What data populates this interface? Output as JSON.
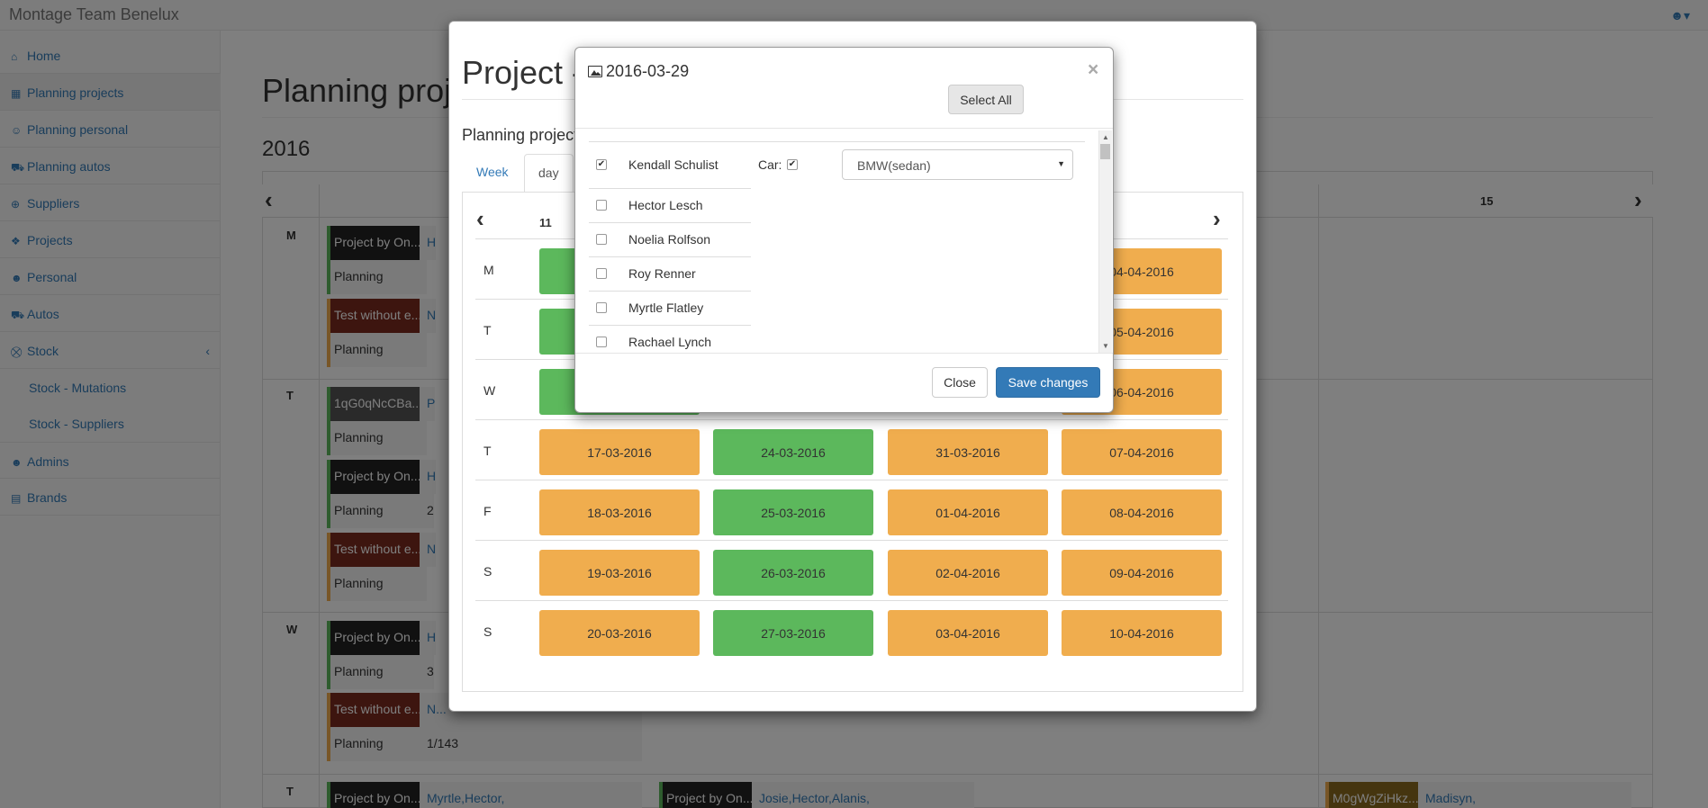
{
  "app": {
    "brand": "Montage Team Benelux",
    "user_icon": "user-icon"
  },
  "sidebar": {
    "items": [
      {
        "label": "Home",
        "icon": "home-icon",
        "glyph": "⌂"
      },
      {
        "label": "Planning projects",
        "icon": "calendar-icon",
        "glyph": "▦"
      },
      {
        "label": "Planning personal",
        "icon": "users-icon",
        "glyph": "☺"
      },
      {
        "label": "Planning autos",
        "icon": "car-icon",
        "glyph": "⛟"
      },
      {
        "label": "Suppliers",
        "icon": "lifebuoy-icon",
        "glyph": "⊕"
      },
      {
        "label": "Projects",
        "icon": "cubes-icon",
        "glyph": "❖"
      },
      {
        "label": "Personal",
        "icon": "user-icon",
        "glyph": "☻"
      },
      {
        "label": "Autos",
        "icon": "car-icon",
        "glyph": "⛟"
      },
      {
        "label": "Stock",
        "icon": "cart-icon",
        "glyph": "⛒"
      },
      {
        "label": "Stock - Mutations",
        "icon": "",
        "glyph": ""
      },
      {
        "label": "Stock - Suppliers",
        "icon": "",
        "glyph": ""
      },
      {
        "label": "Admins",
        "icon": "user-icon",
        "glyph": "☻"
      },
      {
        "label": "Brands",
        "icon": "archive-icon",
        "glyph": "▤"
      }
    ],
    "stock_arrow": "‹"
  },
  "page": {
    "title": "Planning proj",
    "year": "2016",
    "calendar": {
      "header_day": "15",
      "rows": [
        "M",
        "T",
        "W",
        "T"
      ],
      "events": [
        {
          "label": "Project by On...",
          "value": "H"
        },
        {
          "label": "Planning",
          "value": ""
        },
        {
          "label": "Test without e...",
          "value": "N"
        },
        {
          "label": "Planning",
          "value": ""
        },
        {
          "label": "1qG0qNcCBa...",
          "value": "P"
        },
        {
          "label": "Planning",
          "value": ""
        },
        {
          "label": "Project by On...",
          "value": "H"
        },
        {
          "label": "Planning",
          "value": "2"
        },
        {
          "label": "Test without e...",
          "value": "N"
        },
        {
          "label": "Planning",
          "value": ""
        },
        {
          "label": "Project by On...",
          "value": "H"
        },
        {
          "label": "Planning",
          "value": "3"
        },
        {
          "label": "Test without e...",
          "value": "N..."
        },
        {
          "label": "Planning",
          "value": "1/143"
        },
        {
          "label": "Project by On...",
          "value": "Myrtle,Hector,"
        },
        {
          "label": "Project by On...",
          "value": "Josie,Hector,Alanis,"
        },
        {
          "label": "M0gWgZiHkz...",
          "value": "Madisyn,"
        }
      ]
    }
  },
  "modal_project": {
    "title": "Project -",
    "subtitle": "Planning project 2",
    "tabs": [
      "Week",
      "day"
    ],
    "column_header": "11",
    "days": [
      "M",
      "T",
      "W",
      "T",
      "F",
      "S",
      "S"
    ],
    "grid": [
      [
        "",
        "",
        "",
        "04-04-2016"
      ],
      [
        "",
        "",
        "",
        "05-04-2016"
      ],
      [
        "",
        "",
        "",
        "06-04-2016"
      ],
      [
        "17-03-2016",
        "24-03-2016",
        "31-03-2016",
        "07-04-2016"
      ],
      [
        "18-03-2016",
        "25-03-2016",
        "01-04-2016",
        "08-04-2016"
      ],
      [
        "19-03-2016",
        "26-03-2016",
        "02-04-2016",
        "09-04-2016"
      ],
      [
        "20-03-2016",
        "27-03-2016",
        "03-04-2016",
        "10-04-2016"
      ]
    ],
    "grid_colors": [
      [
        "green",
        "",
        "",
        "orange"
      ],
      [
        "green",
        "",
        "",
        "orange"
      ],
      [
        "green",
        "",
        "",
        "orange"
      ],
      [
        "orange",
        "green",
        "orange",
        "orange"
      ],
      [
        "orange",
        "green",
        "orange",
        "orange"
      ],
      [
        "orange",
        "green",
        "orange",
        "orange"
      ],
      [
        "orange",
        "green",
        "orange",
        "orange"
      ]
    ],
    "colors": {
      "orange": "#f0ad4e",
      "green": "#5cb85c"
    }
  },
  "modal_day": {
    "title": "2016-03-29",
    "title_icon": "image-icon",
    "close_glyph": "×",
    "select_all_label": "Select All",
    "car_label": "Car:",
    "car_checked": true,
    "car_selected": "BMW(sedan)",
    "people": [
      {
        "name": "Kendall Schulist",
        "checked": true
      },
      {
        "name": "Hector Lesch",
        "checked": false
      },
      {
        "name": "Noelia Rolfson",
        "checked": false
      },
      {
        "name": "Roy Renner",
        "checked": false
      },
      {
        "name": "Myrtle Flatley",
        "checked": false
      },
      {
        "name": "Rachael Lynch",
        "checked": false
      }
    ],
    "close_label": "Close",
    "save_label": "Save changes"
  }
}
